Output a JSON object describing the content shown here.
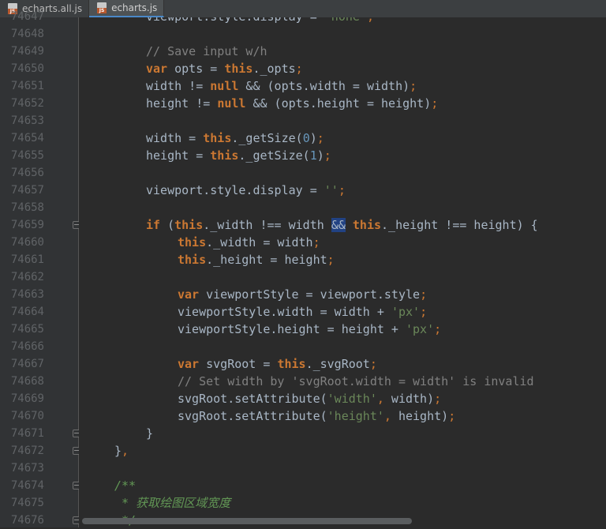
{
  "tabs": [
    {
      "label": "echarts.all.js",
      "icon": "js-file-icon",
      "active": false
    },
    {
      "label": "echarts.js",
      "icon": "js-file-icon",
      "active": true
    }
  ],
  "editor": {
    "lines": [
      {
        "num": "74647",
        "tokens": [
          [
            "id",
            "viewport.style.display = "
          ],
          [
            "str",
            "'none'"
          ],
          [
            "punct",
            ";"
          ]
        ],
        "indent": 2
      },
      {
        "num": "74648",
        "tokens": [],
        "indent": 0
      },
      {
        "num": "74649",
        "tokens": [
          [
            "cmt",
            "// Save input w/h"
          ]
        ],
        "indent": 2
      },
      {
        "num": "74650",
        "tokens": [
          [
            "kw",
            "var"
          ],
          [
            "id",
            " opts = "
          ],
          [
            "kw",
            "this"
          ],
          [
            "id",
            "._opts"
          ],
          [
            "punct",
            ";"
          ]
        ],
        "indent": 2
      },
      {
        "num": "74651",
        "tokens": [
          [
            "id",
            "width != "
          ],
          [
            "kw",
            "null"
          ],
          [
            "id",
            " && (opts.width = width)"
          ],
          [
            "punct",
            ";"
          ]
        ],
        "indent": 2
      },
      {
        "num": "74652",
        "tokens": [
          [
            "id",
            "height != "
          ],
          [
            "kw",
            "null"
          ],
          [
            "id",
            " && (opts.height = height)"
          ],
          [
            "punct",
            ";"
          ]
        ],
        "indent": 2
      },
      {
        "num": "74653",
        "tokens": [],
        "indent": 0
      },
      {
        "num": "74654",
        "tokens": [
          [
            "id",
            "width = "
          ],
          [
            "kw",
            "this"
          ],
          [
            "id",
            "._getSize("
          ],
          [
            "num",
            "0"
          ],
          [
            "id",
            ")"
          ],
          [
            "punct",
            ";"
          ]
        ],
        "indent": 2
      },
      {
        "num": "74655",
        "tokens": [
          [
            "id",
            "height = "
          ],
          [
            "kw",
            "this"
          ],
          [
            "id",
            "._getSize("
          ],
          [
            "num",
            "1"
          ],
          [
            "id",
            ")"
          ],
          [
            "punct",
            ";"
          ]
        ],
        "indent": 2
      },
      {
        "num": "74656",
        "tokens": [],
        "indent": 0
      },
      {
        "num": "74657",
        "tokens": [
          [
            "id",
            "viewport.style.display = "
          ],
          [
            "str",
            "''"
          ],
          [
            "punct",
            ";"
          ]
        ],
        "indent": 2
      },
      {
        "num": "74658",
        "tokens": [],
        "indent": 0
      },
      {
        "num": "74659",
        "tokens": [
          [
            "kw",
            "if"
          ],
          [
            "id",
            " ("
          ],
          [
            "kw",
            "this"
          ],
          [
            "id",
            "._width !== width "
          ],
          [
            "hl",
            "&&"
          ],
          [
            "id",
            " "
          ],
          [
            "kw",
            "this"
          ],
          [
            "id",
            "._height !== height) {"
          ]
        ],
        "indent": 2,
        "fold": true
      },
      {
        "num": "74660",
        "tokens": [
          [
            "kw",
            "this"
          ],
          [
            "id",
            "._width = width"
          ],
          [
            "punct",
            ";"
          ]
        ],
        "indent": 3
      },
      {
        "num": "74661",
        "tokens": [
          [
            "kw",
            "this"
          ],
          [
            "id",
            "._height = height"
          ],
          [
            "punct",
            ";"
          ]
        ],
        "indent": 3
      },
      {
        "num": "74662",
        "tokens": [],
        "indent": 0
      },
      {
        "num": "74663",
        "tokens": [
          [
            "kw",
            "var"
          ],
          [
            "id",
            " viewportStyle = viewport.style"
          ],
          [
            "punct",
            ";"
          ]
        ],
        "indent": 3
      },
      {
        "num": "74664",
        "tokens": [
          [
            "id",
            "viewportStyle.width = width + "
          ],
          [
            "str",
            "'px'"
          ],
          [
            "punct",
            ";"
          ]
        ],
        "indent": 3
      },
      {
        "num": "74665",
        "tokens": [
          [
            "id",
            "viewportStyle.height = height + "
          ],
          [
            "str",
            "'px'"
          ],
          [
            "punct",
            ";"
          ]
        ],
        "indent": 3
      },
      {
        "num": "74666",
        "tokens": [],
        "indent": 0
      },
      {
        "num": "74667",
        "tokens": [
          [
            "kw",
            "var"
          ],
          [
            "id",
            " svgRoot = "
          ],
          [
            "kw",
            "this"
          ],
          [
            "id",
            "._svgRoot"
          ],
          [
            "punct",
            ";"
          ]
        ],
        "indent": 3
      },
      {
        "num": "74668",
        "tokens": [
          [
            "cmt",
            "// Set width by 'svgRoot.width = width' is invalid"
          ]
        ],
        "indent": 3
      },
      {
        "num": "74669",
        "tokens": [
          [
            "id",
            "svgRoot.setAttribute("
          ],
          [
            "str",
            "'width'"
          ],
          [
            "punct",
            ","
          ],
          [
            "id",
            " width)"
          ],
          [
            "punct",
            ";"
          ]
        ],
        "indent": 3
      },
      {
        "num": "74670",
        "tokens": [
          [
            "id",
            "svgRoot.setAttribute("
          ],
          [
            "str",
            "'height'"
          ],
          [
            "punct",
            ","
          ],
          [
            "id",
            " height)"
          ],
          [
            "punct",
            ";"
          ]
        ],
        "indent": 3
      },
      {
        "num": "74671",
        "tokens": [
          [
            "id",
            "}"
          ]
        ],
        "indent": 2,
        "fold": true
      },
      {
        "num": "74672",
        "tokens": [
          [
            "id",
            "}"
          ],
          [
            "punct",
            ","
          ]
        ],
        "indent": 1,
        "fold": true
      },
      {
        "num": "74673",
        "tokens": [],
        "indent": 0
      },
      {
        "num": "74674",
        "tokens": [
          [
            "doc",
            "/**"
          ]
        ],
        "indent": 1,
        "fold": true
      },
      {
        "num": "74675",
        "tokens": [
          [
            "doc",
            " * 获取绘图区域宽度"
          ]
        ],
        "indent": 1
      },
      {
        "num": "74676",
        "tokens": [
          [
            "doc",
            " */"
          ]
        ],
        "indent": 1,
        "fold": true
      }
    ]
  },
  "colors": {
    "background": "#2b2b2b",
    "keyword": "#cc7832",
    "identifier": "#a9b7c6",
    "string": "#6a8759",
    "number": "#6897bb",
    "comment": "#808080",
    "doc_comment": "#629755",
    "selection": "#214283"
  }
}
